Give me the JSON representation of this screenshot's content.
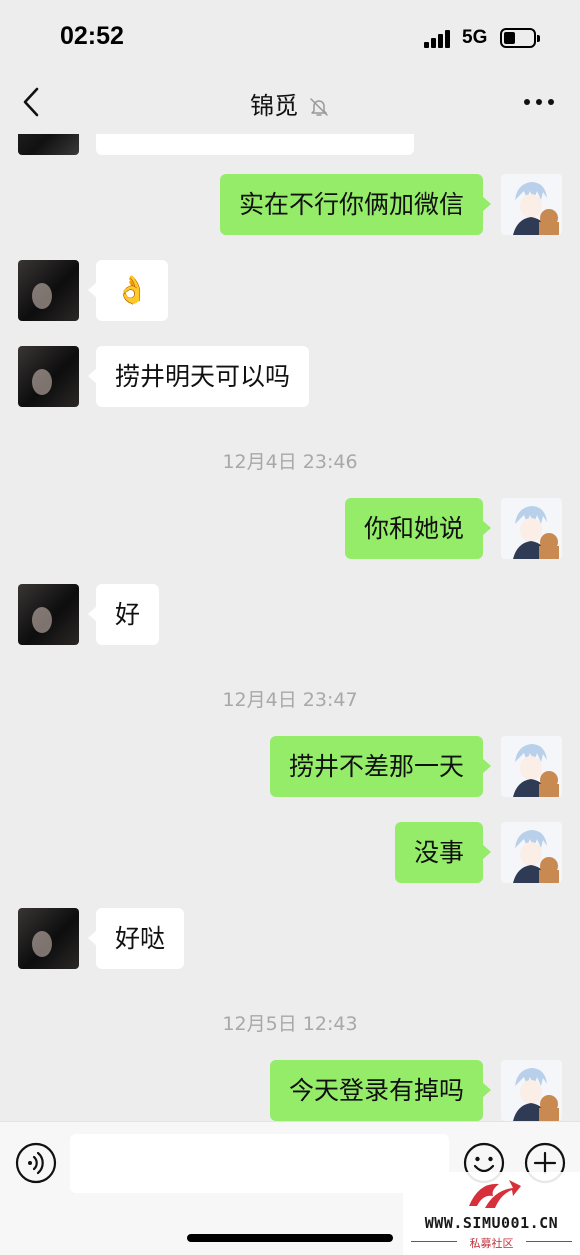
{
  "status_bar": {
    "time": "02:52",
    "network": "5G"
  },
  "header": {
    "title": "锦觅"
  },
  "messages": [
    {
      "side": "right",
      "text": "实在不行你俩加微信"
    },
    {
      "side": "left",
      "text": "👌"
    },
    {
      "side": "left",
      "text": "捞井明天可以吗"
    },
    {
      "type": "time",
      "text": "12月4日 23:46"
    },
    {
      "side": "right",
      "text": "你和她说"
    },
    {
      "side": "left",
      "text": "好"
    },
    {
      "type": "time",
      "text": "12月4日 23:47"
    },
    {
      "side": "right",
      "text": "捞井不差那一天"
    },
    {
      "side": "right",
      "text": "没事"
    },
    {
      "side": "left",
      "text": "好哒"
    },
    {
      "type": "time",
      "text": "12月5日 12:43"
    },
    {
      "side": "right",
      "text": "今天登录有掉吗"
    }
  ],
  "input": {
    "placeholder": ""
  },
  "watermark": {
    "url": "WWW.SIMU001.CN",
    "subtitle": "私募社区"
  },
  "colors": {
    "background": "#ededed",
    "sent_bubble": "#95ec69",
    "received_bubble": "#ffffff"
  },
  "icons": [
    "back-chevron-icon",
    "mute-bell-icon",
    "more-dots-icon",
    "voice-icon",
    "emoji-icon",
    "plus-icon"
  ]
}
